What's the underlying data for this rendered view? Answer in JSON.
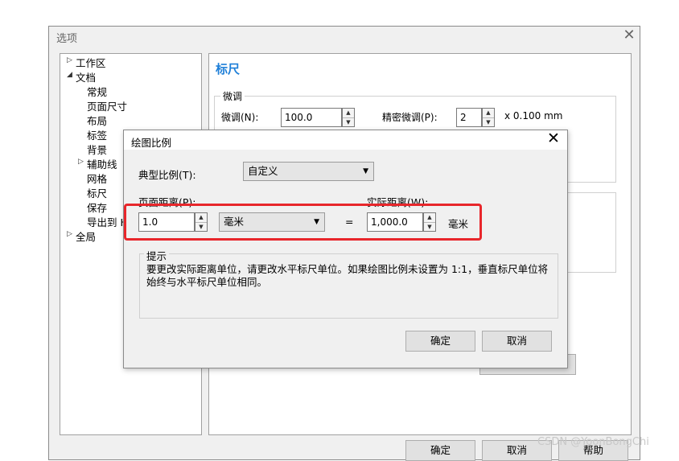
{
  "options_window": {
    "title": "选项",
    "tree": [
      {
        "label": "工作区",
        "arrow": "▷"
      },
      {
        "label": "文档",
        "arrow": "◢"
      },
      {
        "label": "常规"
      },
      {
        "label": "页面尺寸"
      },
      {
        "label": "布局"
      },
      {
        "label": "标签"
      },
      {
        "label": "背景"
      },
      {
        "label": "辅助线",
        "arrow": "▷"
      },
      {
        "label": "网格"
      },
      {
        "label": "标尺"
      },
      {
        "label": "保存"
      },
      {
        "label": "导出到 H"
      },
      {
        "label": "全局",
        "arrow": "▷"
      }
    ],
    "content": {
      "heading": "标尺",
      "nudge_group": "微调",
      "nudge_label": "微调(N):",
      "nudge_value": "100.0",
      "super_nudge_label": "精密微调(P):",
      "super_nudge_value": "2",
      "super_nudge_unit": "x 0.100 mm"
    },
    "buttons": {
      "ok": "确定",
      "cancel": "取消",
      "help": "帮助"
    }
  },
  "scale_dialog": {
    "title": "绘图比例",
    "typical_scale_label": "典型比例(T):",
    "typical_scale_value": "自定义",
    "page_distance_label": "页面距离(P):",
    "page_distance_value": "1.0",
    "page_unit": "毫米",
    "equals": "=",
    "world_distance_label": "实际距离(W):",
    "world_distance_value": "1,000.0",
    "world_unit": "毫米",
    "hint_title": "提示",
    "hint_text": "要更改实际距离单位，请更改水平标尺单位。如果绘图比例未设置为 1:1，垂直标尺单位将始终与水平标尺单位相同。",
    "ok": "确定",
    "cancel": "取消"
  },
  "highlight_color": "#e8262b",
  "watermark": "CSDN @YoonBongChi"
}
